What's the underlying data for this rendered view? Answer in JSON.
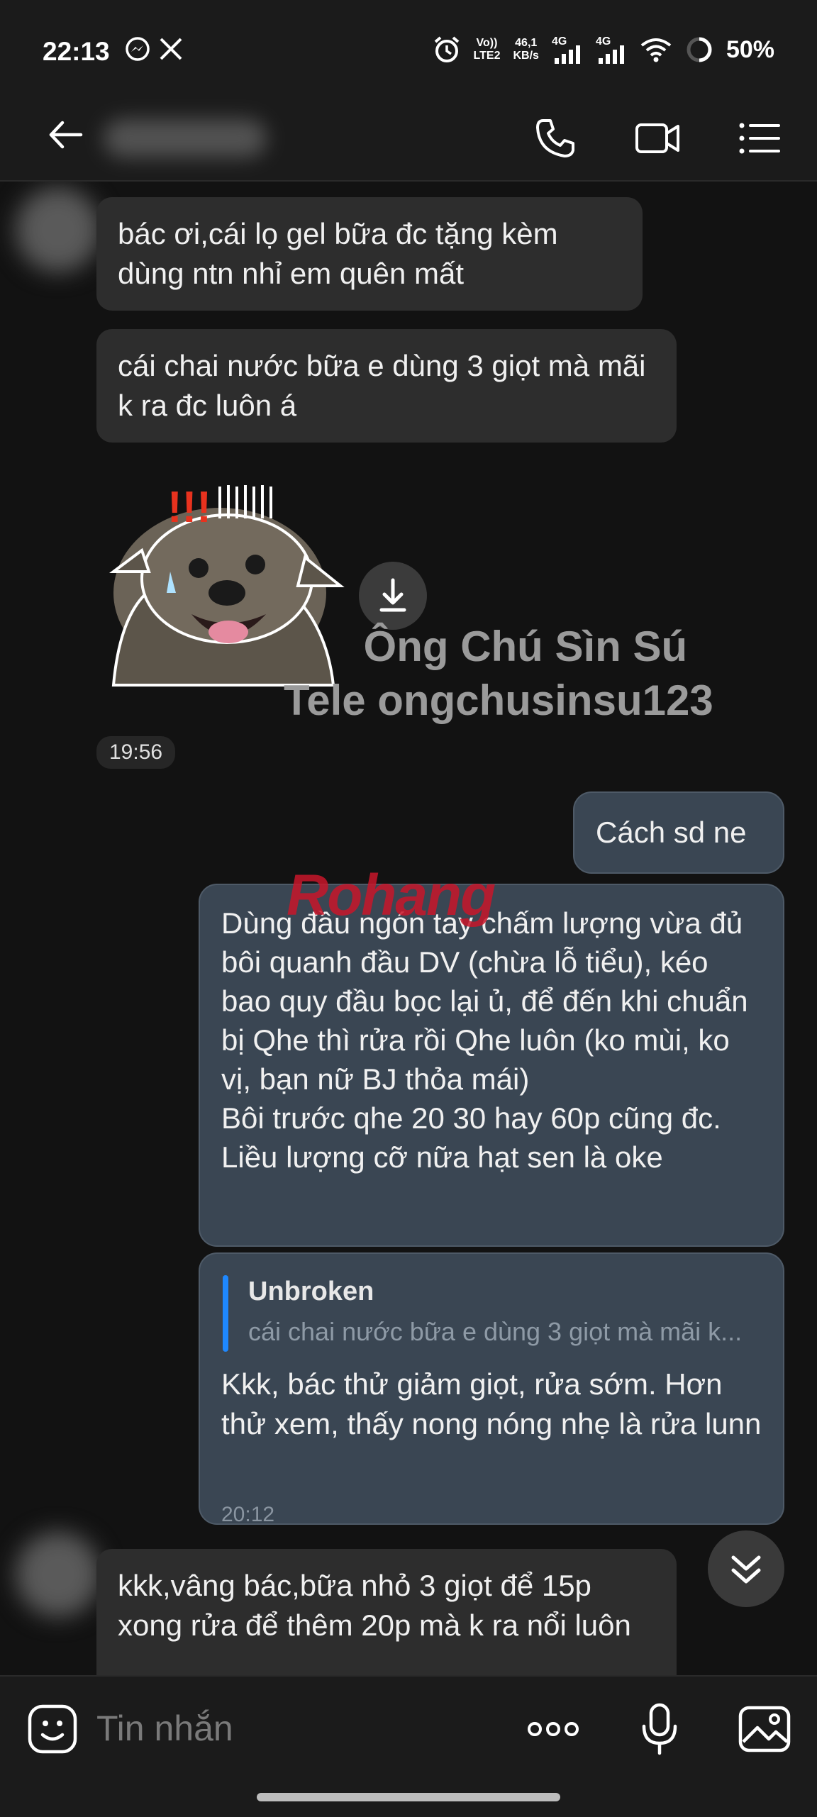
{
  "status_bar": {
    "time": "22:13",
    "volte": "Vo))",
    "lte2": "LTE2",
    "speed_value": "46,1",
    "speed_unit": "KB/s",
    "net1": "4G",
    "net2": "4G",
    "battery": "50%"
  },
  "messages": {
    "in1": "bác ơi,cái lọ gel bữa đc tặng kèm dùng ntn nhỉ em quên mất",
    "in2": "cái chai nước bữa e dùng 3 giọt mà mãi k ra đc luôn á",
    "sticker_alert": "!!!",
    "watermark_line1": "Ông Chú Sìn Sú",
    "watermark_line2": "Tele ongchusinsu123",
    "time1": "19:56",
    "out1": "Cách sd ne",
    "out2_p1": "Dùng đầu ngón tay chấm lượng vừa đủ bôi quanh đầu DV (chừa lỗ tiểu), kéo bao quy đầu bọc lại ủ, để đến khi chuẩn bị Qhe thì rửa rồi Qhe luôn (ko mùi, ko vị, bạn nữ BJ thỏa mái)",
    "out2_p2": "Bôi trước qhe 20 30 hay 60p cũng đc. Liều lượng cỡ nữa hạt sen là oke",
    "logo_watermark": "Rohang",
    "reply_name": "Unbroken",
    "reply_snippet": "cái chai nước bữa e dùng 3 giọt mà mãi k...",
    "out3": "Kkk, bác thử giảm giọt, rửa sớm. Hơn thử xem, thấy nong nóng nhẹ là rửa lunn",
    "time2": "20:12",
    "in3": "kkk,vâng bác,bữa nhỏ 3 giọt để 15p xong rửa để thêm 20p mà k ra nổi luôn"
  },
  "composer": {
    "placeholder": "Tin nhắn"
  },
  "colors": {
    "background": "#121212",
    "incoming_bubble": "#2d2d2d",
    "outgoing_bubble": "#3a4653",
    "reply_accent": "#1e88ff"
  },
  "icons": [
    "back-arrow-icon",
    "phone-icon",
    "video-camera-icon",
    "menu-list-icon",
    "download-icon",
    "chevron-double-down-icon",
    "emoji-sticker-icon",
    "more-dots-icon",
    "microphone-icon",
    "image-gallery-icon",
    "messenger-icon",
    "x-logo-icon",
    "alarm-icon",
    "signal-icon",
    "wifi-icon",
    "battery-ring-icon"
  ]
}
